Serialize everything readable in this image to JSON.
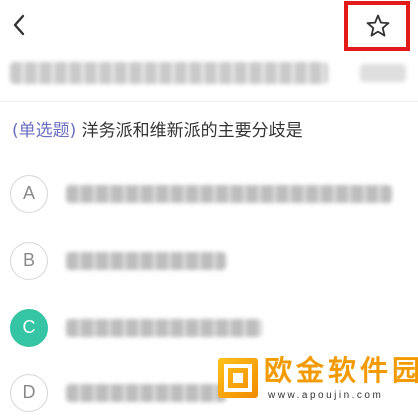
{
  "header": {
    "back_icon": "chevron-left-icon",
    "favorite_icon": "star-outline-icon",
    "highlight_color": "#e21a1a"
  },
  "question": {
    "type_label": "(单选题)",
    "text": "洋务派和维新派的主要分歧是"
  },
  "options": [
    {
      "letter": "A",
      "selected": false
    },
    {
      "letter": "B",
      "selected": false
    },
    {
      "letter": "C",
      "selected": true
    },
    {
      "letter": "D",
      "selected": false
    }
  ],
  "colors": {
    "selected_option": "#35c4a4",
    "question_type": "#6a6fbf",
    "text": "#333333"
  },
  "watermark": {
    "name": "欧金软件园",
    "url": "www.apoujin.com"
  }
}
